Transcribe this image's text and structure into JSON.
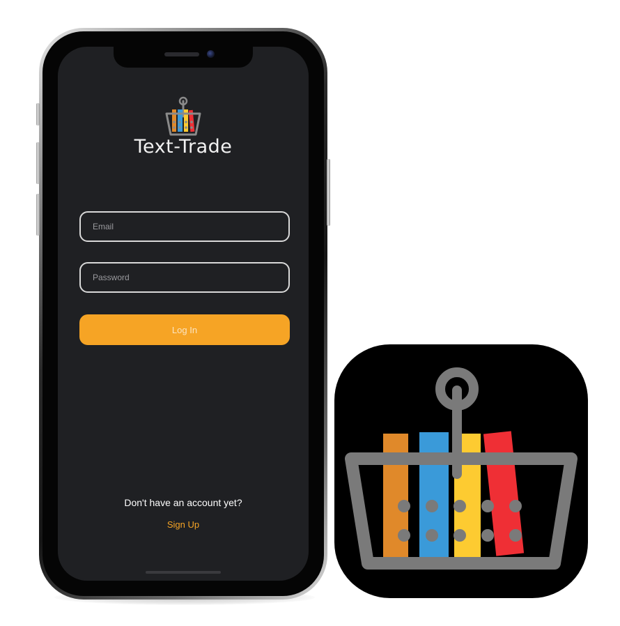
{
  "app": {
    "title": "Text-Trade"
  },
  "login_form": {
    "email_placeholder": "Email",
    "password_placeholder": "Password",
    "login_label": "Log In"
  },
  "footer": {
    "no_account_text": "Don't have an account yet?",
    "signup_label": "Sign Up"
  },
  "colors": {
    "screen_background": "#1f2023",
    "accent_orange": "#f6a425",
    "book_orange": "#e0892a",
    "book_blue": "#3a9ad9",
    "book_yellow": "#fdcb31",
    "book_red": "#ef2f35",
    "basket_gray": "#7a7a7a"
  },
  "icons": {
    "app_logo": "book-basket-icon"
  }
}
